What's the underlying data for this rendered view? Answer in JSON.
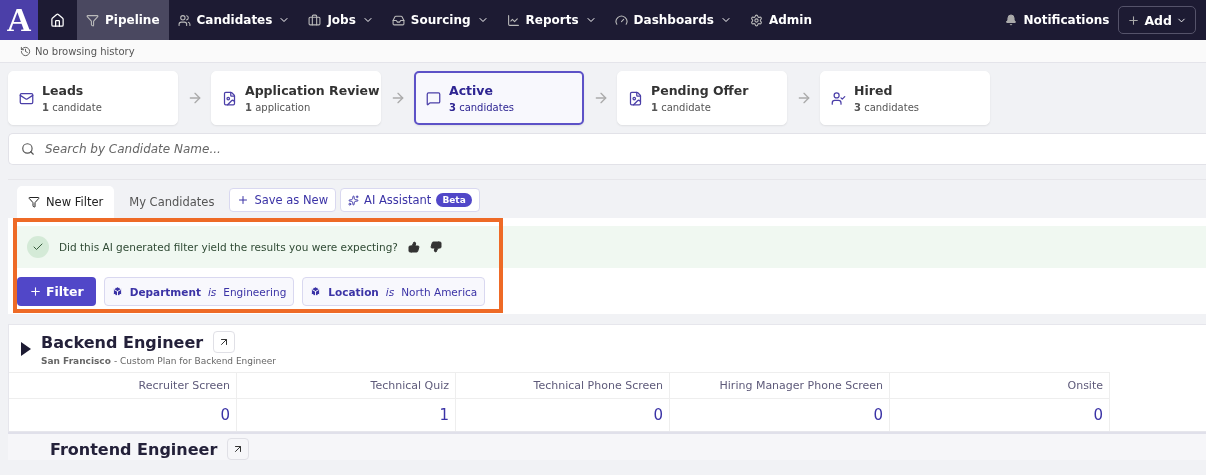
{
  "nav": {
    "logo": "A",
    "items": [
      {
        "label": "Pipeline",
        "selected": true,
        "dropdown": false
      },
      {
        "label": "Candidates",
        "selected": false,
        "dropdown": true
      },
      {
        "label": "Jobs",
        "selected": false,
        "dropdown": true
      },
      {
        "label": "Sourcing",
        "selected": false,
        "dropdown": true
      },
      {
        "label": "Reports",
        "selected": false,
        "dropdown": true
      },
      {
        "label": "Dashboards",
        "selected": false,
        "dropdown": true
      },
      {
        "label": "Admin",
        "selected": false,
        "dropdown": false
      }
    ],
    "notifications": "Notifications",
    "add": "Add"
  },
  "history": "No browsing history",
  "stages": [
    {
      "title": "Leads",
      "count": "1",
      "unit": "candidate",
      "selected": false
    },
    {
      "title": "Application Review",
      "count": "1",
      "unit": "application",
      "selected": false
    },
    {
      "title": "Active",
      "count": "3",
      "unit": "candidates",
      "selected": true
    },
    {
      "title": "Pending Offer",
      "count": "1",
      "unit": "candidate",
      "selected": false
    },
    {
      "title": "Hired",
      "count": "3",
      "unit": "candidates",
      "selected": false
    }
  ],
  "search": {
    "placeholder": "Search by Candidate Name..."
  },
  "filter_tabs": [
    {
      "label": "New Filter",
      "selected": true
    },
    {
      "label": "My Candidates",
      "selected": false
    }
  ],
  "save_button": "Save as New",
  "ai_button": {
    "label": "AI Assistant",
    "badge": "Beta"
  },
  "feedback": "Did this AI generated filter yield the results you were expecting?",
  "filter_button": "Filter",
  "chips": [
    {
      "field": "Department",
      "op": "is",
      "value": "Engineering"
    },
    {
      "field": "Location",
      "op": "is",
      "value": "North America"
    }
  ],
  "jobs": [
    {
      "title": "Backend Engineer",
      "location": "San Francisco",
      "plan": "- Custom Plan for Backend Engineer",
      "columns": [
        "Recruiter Screen",
        "Technical Quiz",
        "Technical Phone Screen",
        "Hiring Manager Phone Screen",
        "Onsite"
      ],
      "values": [
        "0",
        "1",
        "0",
        "0",
        "0"
      ]
    },
    {
      "title": "Frontend Engineer"
    }
  ]
}
